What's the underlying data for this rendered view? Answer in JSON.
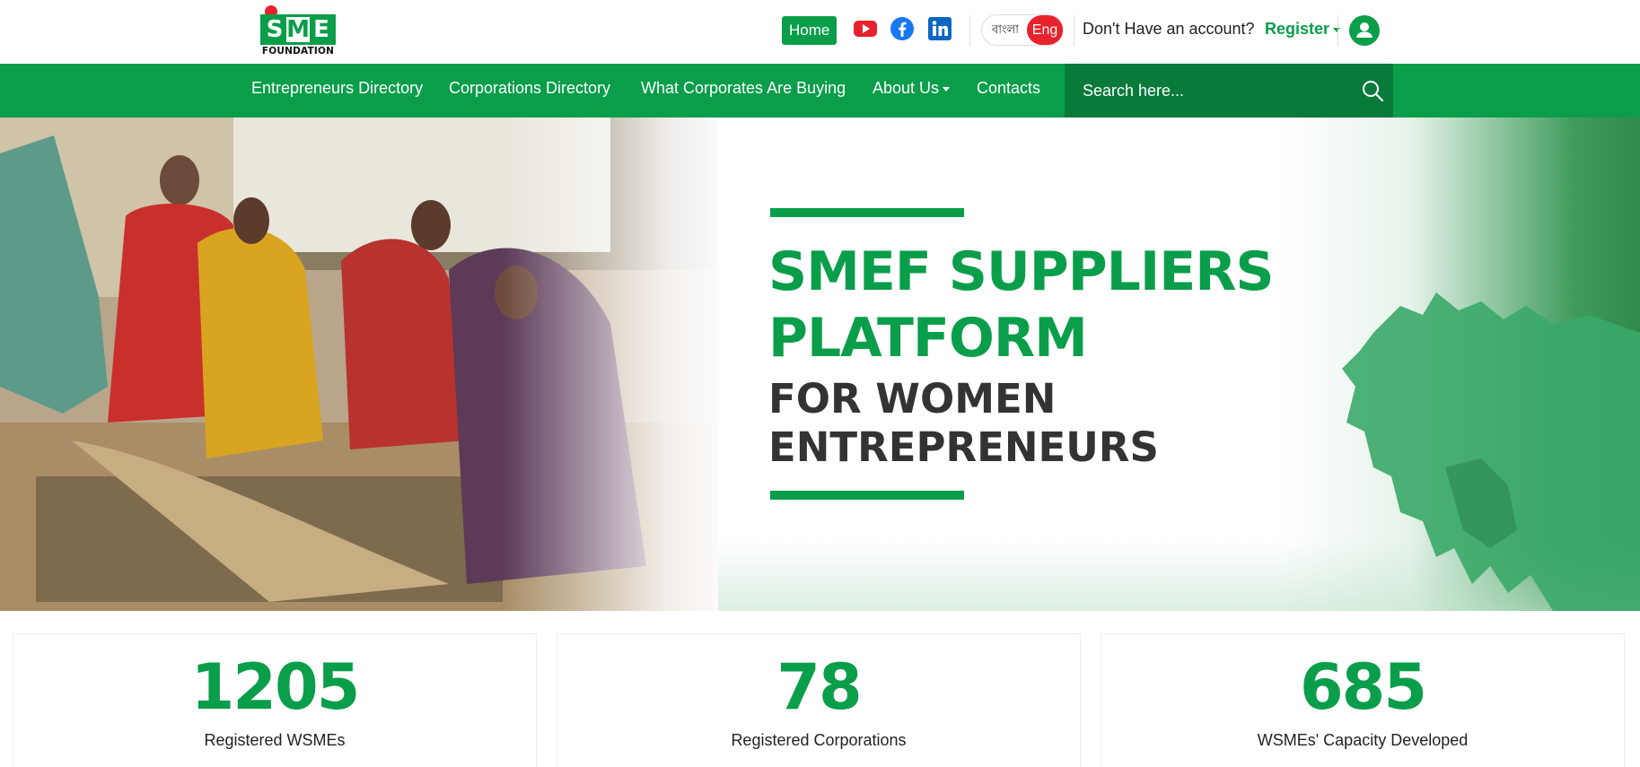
{
  "logo": {
    "letters": [
      "S",
      "M",
      "E"
    ],
    "subtitle": "FOUNDATION"
  },
  "topbar": {
    "home_label": "Home",
    "social": [
      "youtube-icon",
      "facebook-icon",
      "linkedin-icon"
    ],
    "lang_bn": "বাংলা",
    "lang_en": "Eng",
    "account_question": "Don't Have an account?",
    "register_label": "Register"
  },
  "nav": {
    "items": [
      {
        "label": "Entrepreneurs Directory"
      },
      {
        "label": "Corporations Directory"
      },
      {
        "label": "What Corporates Are Buying"
      },
      {
        "label": "About Us"
      },
      {
        "label": "Contacts"
      }
    ],
    "search_placeholder": "Search here..."
  },
  "hero": {
    "line1": "SMEF SUPPLIERS",
    "line2": "PLATFORM",
    "line3": "FOR WOMEN",
    "line4": "ENTREPRENEURS"
  },
  "stats": [
    {
      "value": "1205",
      "label": "Registered WSMEs"
    },
    {
      "value": "78",
      "label": "Registered Corporations"
    },
    {
      "value": "685",
      "label": "WSMEs' Capacity Developed"
    }
  ],
  "colors": {
    "brand_green": "#0a9e4a",
    "dark_green": "#087a3a",
    "accent_red": "#e8222b"
  }
}
